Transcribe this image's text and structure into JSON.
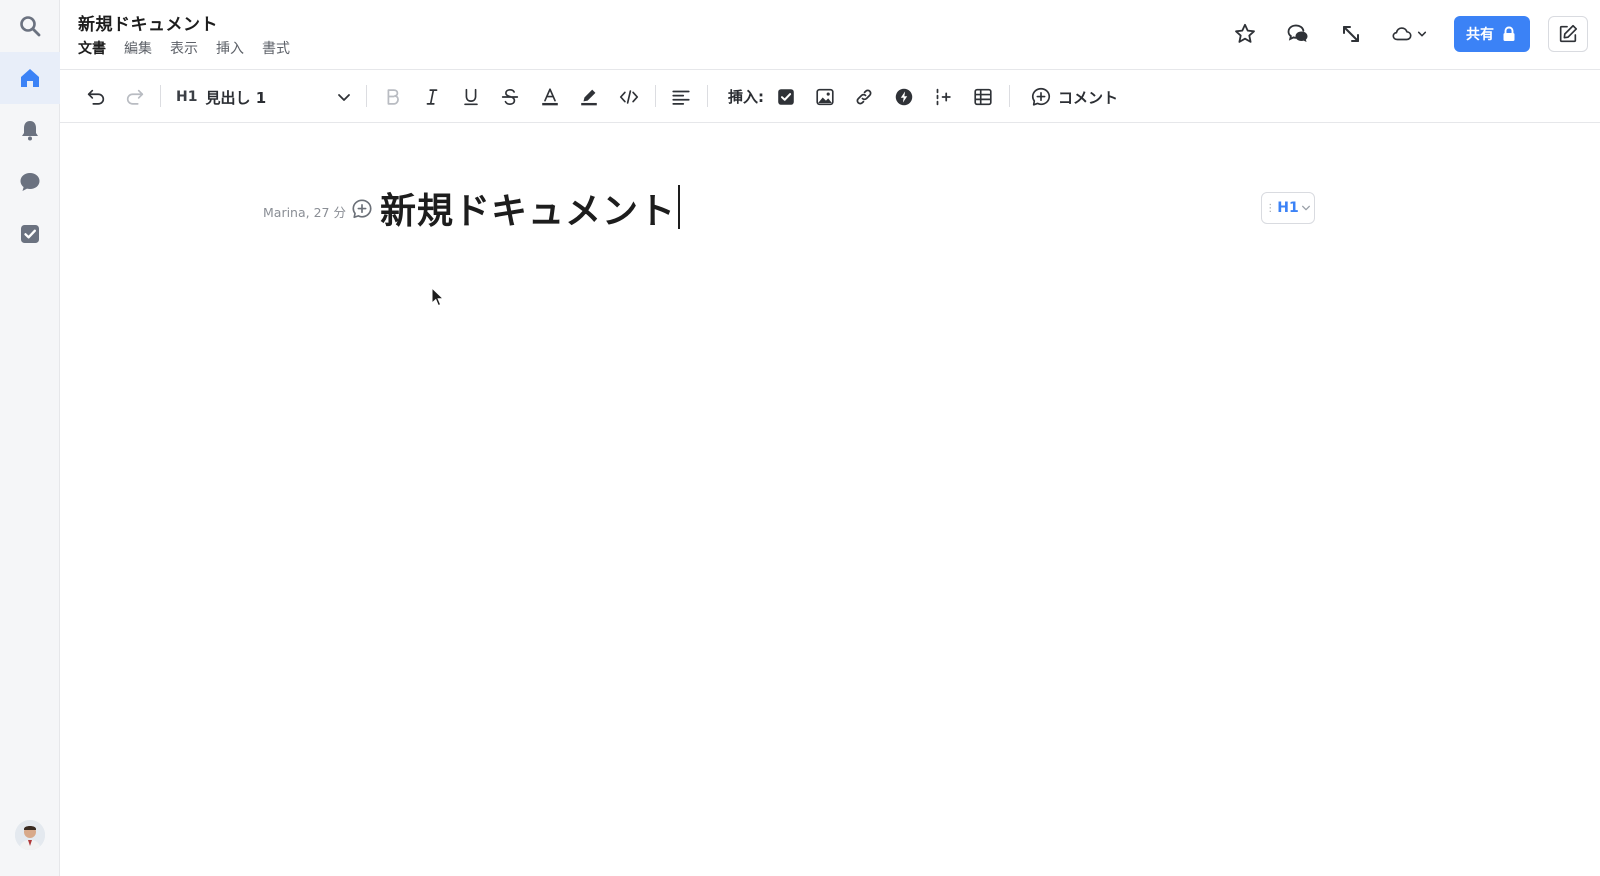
{
  "app": {
    "doc_title": "新規ドキュメント",
    "menu": [
      "文書",
      "編集",
      "表示",
      "挿入",
      "書式"
    ]
  },
  "sidebar": {
    "items": [
      {
        "icon": "search-icon"
      },
      {
        "icon": "home-icon",
        "active": true
      },
      {
        "icon": "bell-icon"
      },
      {
        "icon": "chat-icon"
      },
      {
        "icon": "checkbox-icon"
      }
    ]
  },
  "header": {
    "share_label": "共有"
  },
  "toolbar": {
    "block_style_tag": "H1",
    "block_style_label": "見出し 1",
    "insert_label": "挿入:",
    "comment_label": "コメント"
  },
  "document": {
    "meta": "Marina, 27 分",
    "heading": "新規ドキュメント",
    "block_badge": "H1"
  },
  "colors": {
    "accent": "#3b82f6",
    "sidebar_bg": "#f5f6f8",
    "active_item_bg": "#e8eef9"
  }
}
